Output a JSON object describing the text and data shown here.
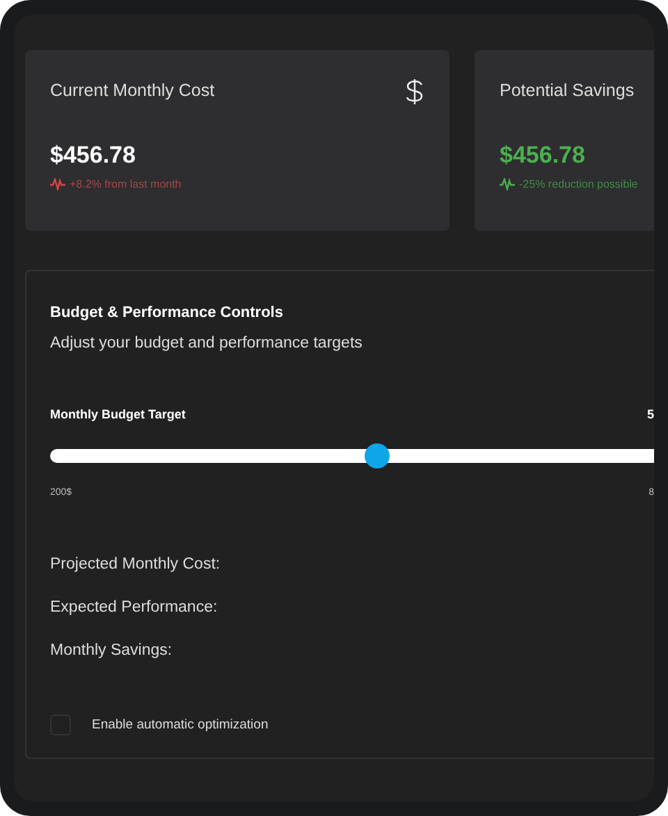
{
  "stat_cards": [
    {
      "title": "Current Monthly Cost",
      "value": "$456.78",
      "trend": "+8.2% from last month",
      "kind": "cost"
    },
    {
      "title": "Potential Savings",
      "value": "$456.78",
      "trend": "-25% reduction possible",
      "kind": "savings"
    }
  ],
  "controls": {
    "title": "Budget & Performance Controls",
    "subtitle": "Adjust your budget and performance targets",
    "slider": {
      "label": "Monthly Budget Target",
      "value": "5",
      "level": 0.5,
      "min_label": "200$",
      "max_label": "8"
    },
    "summary": [
      "Projected Monthly Cost:",
      "Expected Performance:",
      "Monthly Savings:"
    ],
    "auto_optimize": {
      "label": "Enable automatic optimization",
      "checked": false
    }
  }
}
